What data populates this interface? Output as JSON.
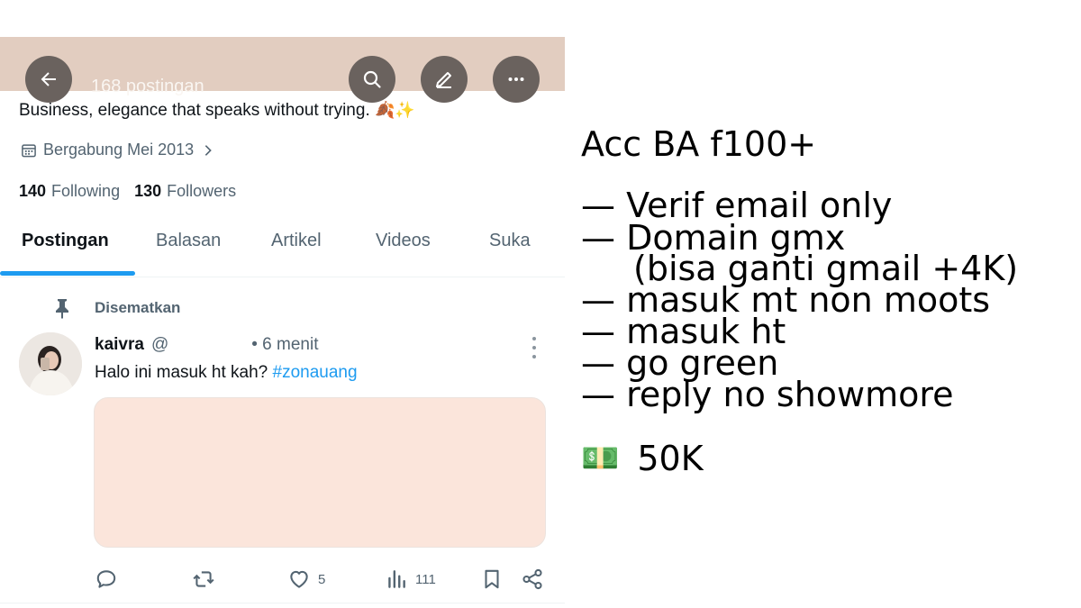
{
  "profile": {
    "post_count": "168 postingan",
    "bio": "Business, elegance that speaks without trying.",
    "bio_emoji": "🍂✨",
    "joined": "Bergabung Mei 2013",
    "following_count": "140",
    "following_label": "Following",
    "followers_count": "130",
    "followers_label": "Followers",
    "tabs": [
      {
        "label": "Postingan",
        "active": true
      },
      {
        "label": "Balasan",
        "active": false
      },
      {
        "label": "Artikel",
        "active": false
      },
      {
        "label": "Videos",
        "active": false
      },
      {
        "label": "Suka",
        "active": false
      }
    ],
    "accent_color": "#1d9bf0"
  },
  "pinned_post": {
    "pinned_label": "Disematkan",
    "author_name": "kaivra",
    "author_handle": "@",
    "time": "• 6 menit",
    "text": "Halo ini masuk ht kah?",
    "hashtag": "#zonauang",
    "likes": "5",
    "views": "111"
  },
  "promo": {
    "title": "Acc BA f100+",
    "lines": [
      "— Verif email only",
      "— Domain gmx",
      "(bisa ganti gmail +4K)",
      "— masuk mt non moots",
      "— masuk ht",
      "— go green",
      "— reply no showmore"
    ],
    "price_emoji": "💵",
    "price": "50K"
  }
}
